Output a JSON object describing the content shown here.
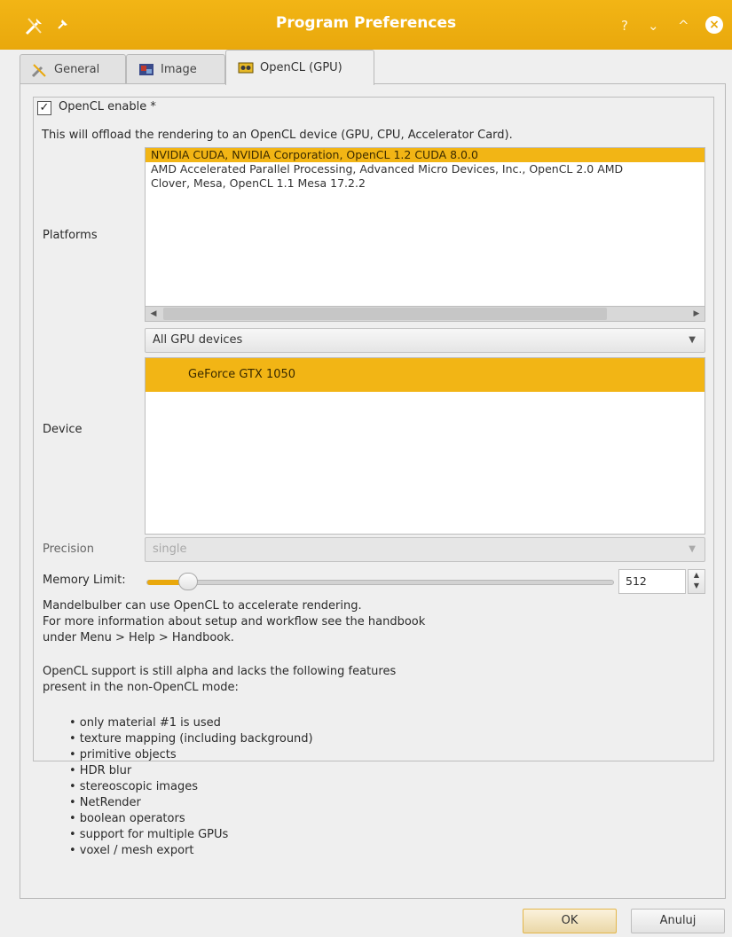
{
  "window": {
    "title": "Program Preferences",
    "controls": {
      "help": "?",
      "minimize": "⌄",
      "maximize": "^",
      "close": "×"
    }
  },
  "tabs": [
    {
      "label": "General",
      "icon": "tools-icon"
    },
    {
      "label": "Image",
      "icon": "image-icon"
    },
    {
      "label": "OpenCL (GPU)",
      "icon": "gpu-icon",
      "active": true
    }
  ],
  "opencl": {
    "enable_label": "OpenCL enable *",
    "enable_checked": true,
    "description": "This will offload the rendering to an OpenCL device (GPU, CPU, Accelerator Card).",
    "platforms_label": "Platforms",
    "platforms": [
      "NVIDIA CUDA, NVIDIA Corporation, OpenCL 1.2 CUDA 8.0.0",
      "AMD Accelerated Parallel Processing, Advanced Micro Devices, Inc., OpenCL 2.0 AMD",
      "Clover, Mesa, OpenCL 1.1 Mesa 17.2.2"
    ],
    "device_filter": "All GPU devices",
    "device_label": "Device",
    "devices": [
      "GeForce GTX 1050"
    ],
    "precision_label": "Precision",
    "precision_value": "single",
    "memory_label": "Memory Limit:",
    "memory_value": "512",
    "memory_fraction": 0.06
  },
  "info": {
    "lines": [
      "Mandelbulber can use OpenCL to accelerate rendering.",
      "For more information about setup and workflow see the handbook",
      "under Menu > Help > Handbook.",
      "OpenCL support is still alpha and lacks the following features",
      "present in the non-OpenCL mode:"
    ],
    "features": [
      "• only material #1 is used",
      "• texture mapping (including background)",
      "• primitive objects",
      "• HDR blur",
      "• stereoscopic images",
      "• NetRender",
      "• boolean operators",
      "• support for multiple GPUs",
      "• voxel / mesh export"
    ]
  },
  "buttons": {
    "ok": "OK",
    "cancel": "Anuluj"
  },
  "colors": {
    "accent": "#f2b515",
    "titlebar": "#e9a80c"
  }
}
